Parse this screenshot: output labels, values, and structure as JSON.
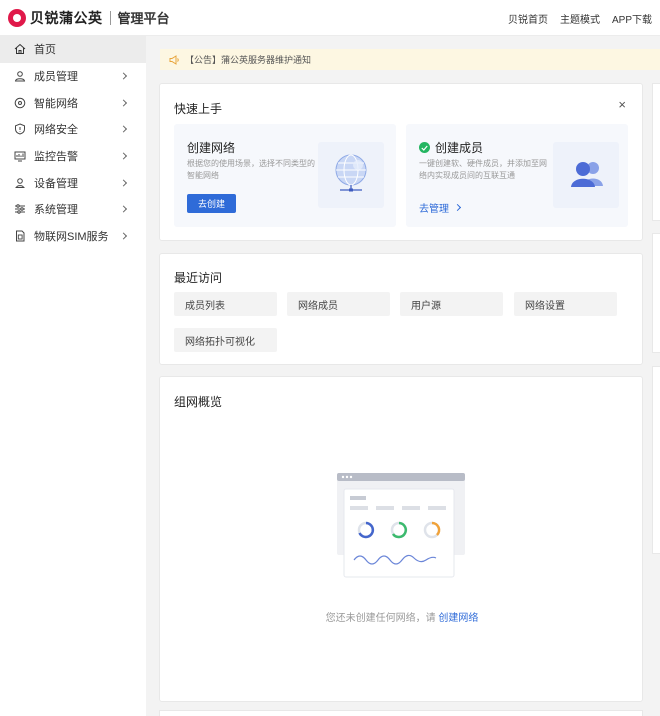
{
  "header": {
    "brand_name": "贝锐蒲公英",
    "brand_sub": "管理平台",
    "links": [
      "贝锐首页",
      "主题模式",
      "APP下载"
    ]
  },
  "sidebar": {
    "items": [
      {
        "label": "首页",
        "icon": "home-icon",
        "active": true
      },
      {
        "label": "成员管理",
        "icon": "user-icon"
      },
      {
        "label": "智能网络",
        "icon": "network-icon"
      },
      {
        "label": "网络安全",
        "icon": "shield-icon"
      },
      {
        "label": "监控告警",
        "icon": "monitor-icon"
      },
      {
        "label": "设备管理",
        "icon": "device-icon"
      },
      {
        "label": "系统管理",
        "icon": "settings-icon"
      },
      {
        "label": "物联网SIM服务",
        "icon": "sim-icon"
      }
    ]
  },
  "notice": {
    "text": "【公告】蒲公英服务器维护通知",
    "icon": "megaphone-icon"
  },
  "quick_start": {
    "title": "快速上手",
    "close": "×",
    "create_network": {
      "title": "创建网络",
      "desc": "根据您的使用场景，选择不同类型的智能网络",
      "button": "去创建"
    },
    "create_member": {
      "title": "创建成员",
      "desc": "一键创建软、硬件成员，并添加至网络内实现成员间的互联互通",
      "link": "去管理"
    }
  },
  "recent": {
    "title": "最近访问",
    "items": [
      "成员列表",
      "网络成员",
      "用户源",
      "网络设置",
      "网络拓扑可视化"
    ]
  },
  "overview": {
    "title": "组网概览",
    "empty_text": "您还未创建任何网络，请",
    "empty_link": "创建网络"
  },
  "colors": {
    "primary": "#2f6bd8",
    "brand": "#e0194a",
    "success": "#24b561",
    "notice_bg": "#fdf7e2"
  }
}
